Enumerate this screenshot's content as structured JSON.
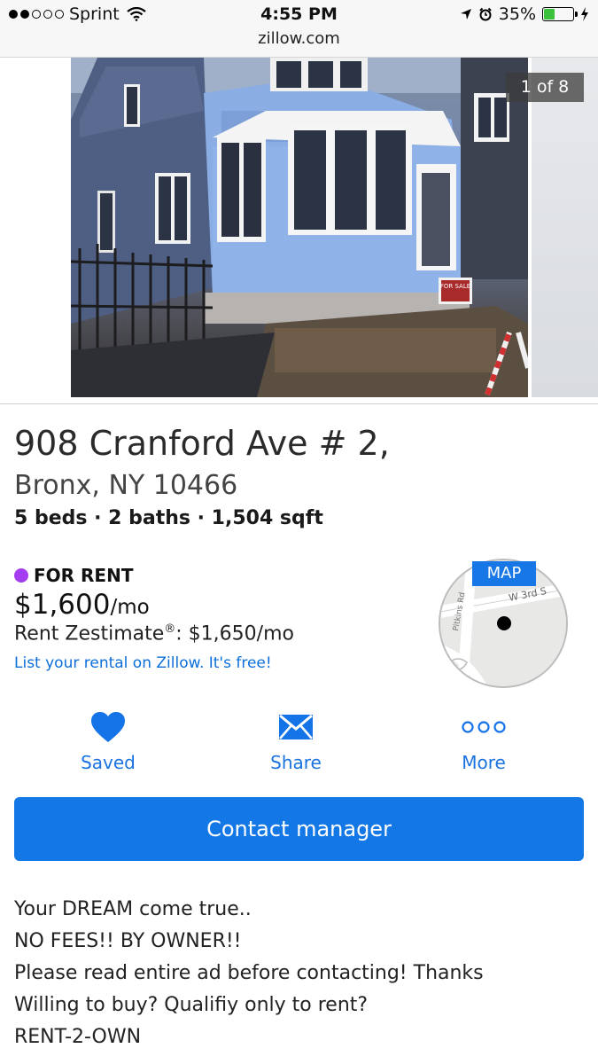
{
  "status_bar": {
    "carrier": "Sprint",
    "time": "4:55 PM",
    "battery": "35%",
    "url": "zillow.com"
  },
  "gallery": {
    "counter": "1 of 8",
    "current": 1,
    "total": 8,
    "sign_text": "FOR SALE"
  },
  "listing": {
    "address_line1": "908 Cranford Ave # 2,",
    "address_line2": "Bronx, NY 10466",
    "facts": "5 beds · 2 baths · 1,504 sqft",
    "status": "FOR RENT",
    "status_color": "#a43ef0",
    "price": "$1,600",
    "price_unit": "/mo",
    "zestimate_label": "Rent Zestimate",
    "zestimate_sup": "®",
    "zestimate_value": ": $1,650/mo",
    "list_link": "List your rental on Zillow. It's free!"
  },
  "map": {
    "button_label": "MAP",
    "street1": "W 3rd S",
    "street2": "Pitkins Rd"
  },
  "actions": {
    "saved": "Saved",
    "share": "Share",
    "more": "More"
  },
  "contact_button": "Contact manager",
  "description": [
    "Your DREAM come true..",
    "NO FEES!! BY OWNER!!",
    "Please read entire ad before contacting! Thanks",
    "Willing to buy? Qualifiy only to rent?",
    "RENT-2-OWN"
  ],
  "colors": {
    "accent": "#1477e6",
    "link": "#0c6fd9"
  }
}
